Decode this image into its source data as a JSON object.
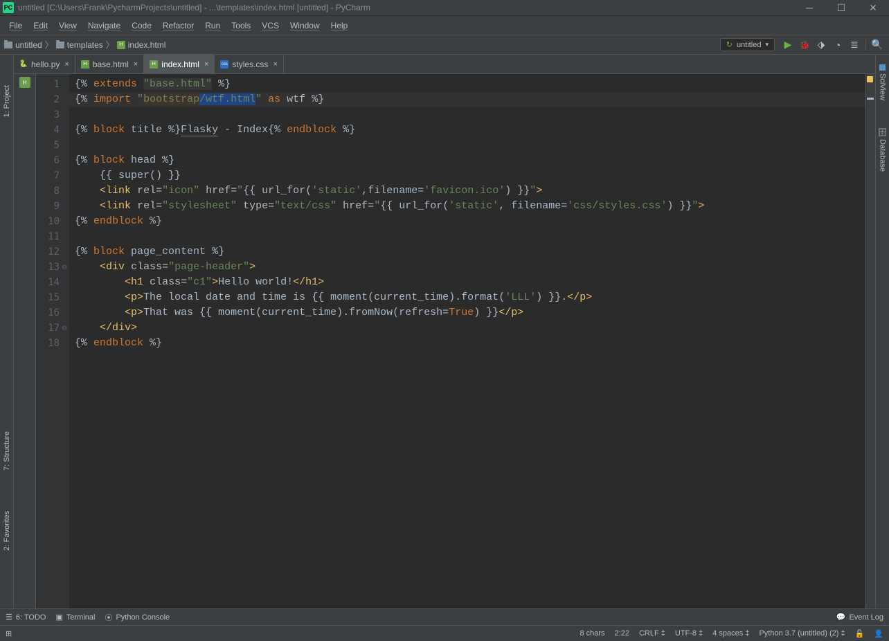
{
  "title": "untitled [C:\\Users\\Frank\\PycharmProjects\\untitled] - ...\\templates\\index.html [untitled] - PyCharm",
  "menu": [
    "File",
    "Edit",
    "View",
    "Navigate",
    "Code",
    "Refactor",
    "Run",
    "Tools",
    "VCS",
    "Window",
    "Help"
  ],
  "breadcrumb": [
    {
      "icon": "folder",
      "label": "untitled"
    },
    {
      "icon": "folder",
      "label": "templates"
    },
    {
      "icon": "html",
      "label": "index.html"
    }
  ],
  "run_config": "untitled",
  "tabs": [
    {
      "icon": "py",
      "label": "hello.py",
      "active": false
    },
    {
      "icon": "html",
      "label": "base.html",
      "active": false
    },
    {
      "icon": "html",
      "label": "index.html",
      "active": true
    },
    {
      "icon": "css",
      "label": "styles.css",
      "active": false
    }
  ],
  "left_tools": [
    "1: Project",
    "7: Structure",
    "2: Favorites"
  ],
  "right_tools": [
    "SciView",
    "Database"
  ],
  "bottom_tools": [
    {
      "icon": "☰",
      "label": "6: TODO"
    },
    {
      "icon": "▣",
      "label": "Terminal"
    },
    {
      "icon": "⦿",
      "label": "Python Console"
    }
  ],
  "event_log": "Event Log",
  "status": {
    "chars": "8 chars",
    "pos": "2:22",
    "le": "CRLF",
    "enc": "UTF-8",
    "indent": "4 spaces",
    "interp": "Python 3.7 (untitled) (2)"
  },
  "code_lines": [
    1,
    2,
    3,
    4,
    5,
    6,
    7,
    8,
    9,
    10,
    11,
    12,
    13,
    14,
    15,
    16,
    17,
    18
  ],
  "code": {
    "l1_extends": "extends",
    "l1_base": "\"base.html\"",
    "l2_import": "import",
    "l2_bootstrap": "bootstrap",
    "l2_wtf": "wtf.html",
    "l2_as": "as",
    "l2_wtf_alias": "wtf",
    "l4_block": "block",
    "l4_title": "title",
    "l4_flasky_text": "Flasky - Index",
    "l4_endblock": "endblock",
    "l6_head": "head",
    "l7_super": "super",
    "l8_link": "link",
    "l8_rel": "rel=",
    "l8_icon": "\"icon\"",
    "l8_href": "href=",
    "l8_url": "url_for",
    "l8_static": "'static'",
    "l8_fn": "filename=",
    "l8_fav": "'favicon.ico'",
    "l9_style": "\"stylesheet\"",
    "l9_type": "type=",
    "l9_css_t": "\"text/css\"",
    "l9_css": "'css/styles.css'",
    "l10_endblock": "endblock",
    "l12_pc": "page_content",
    "l13_div": "div",
    "l13_class": "class=",
    "l13_ph": "\"page-header\"",
    "l14_h1": "h1",
    "l14_c1": "\"c1\"",
    "l14_hello": "Hello world!",
    "l15_txt": "The local date and time is ",
    "l15_moment": "moment",
    "l15_ct": "current_time",
    "l15_format": "format",
    "l15_lll": "'LLL'",
    "l16_that": "That was ",
    "l16_fromNow": "fromNow",
    "l16_refresh": "refresh=",
    "l16_true": "True",
    "l18_endblock": "endblock"
  }
}
